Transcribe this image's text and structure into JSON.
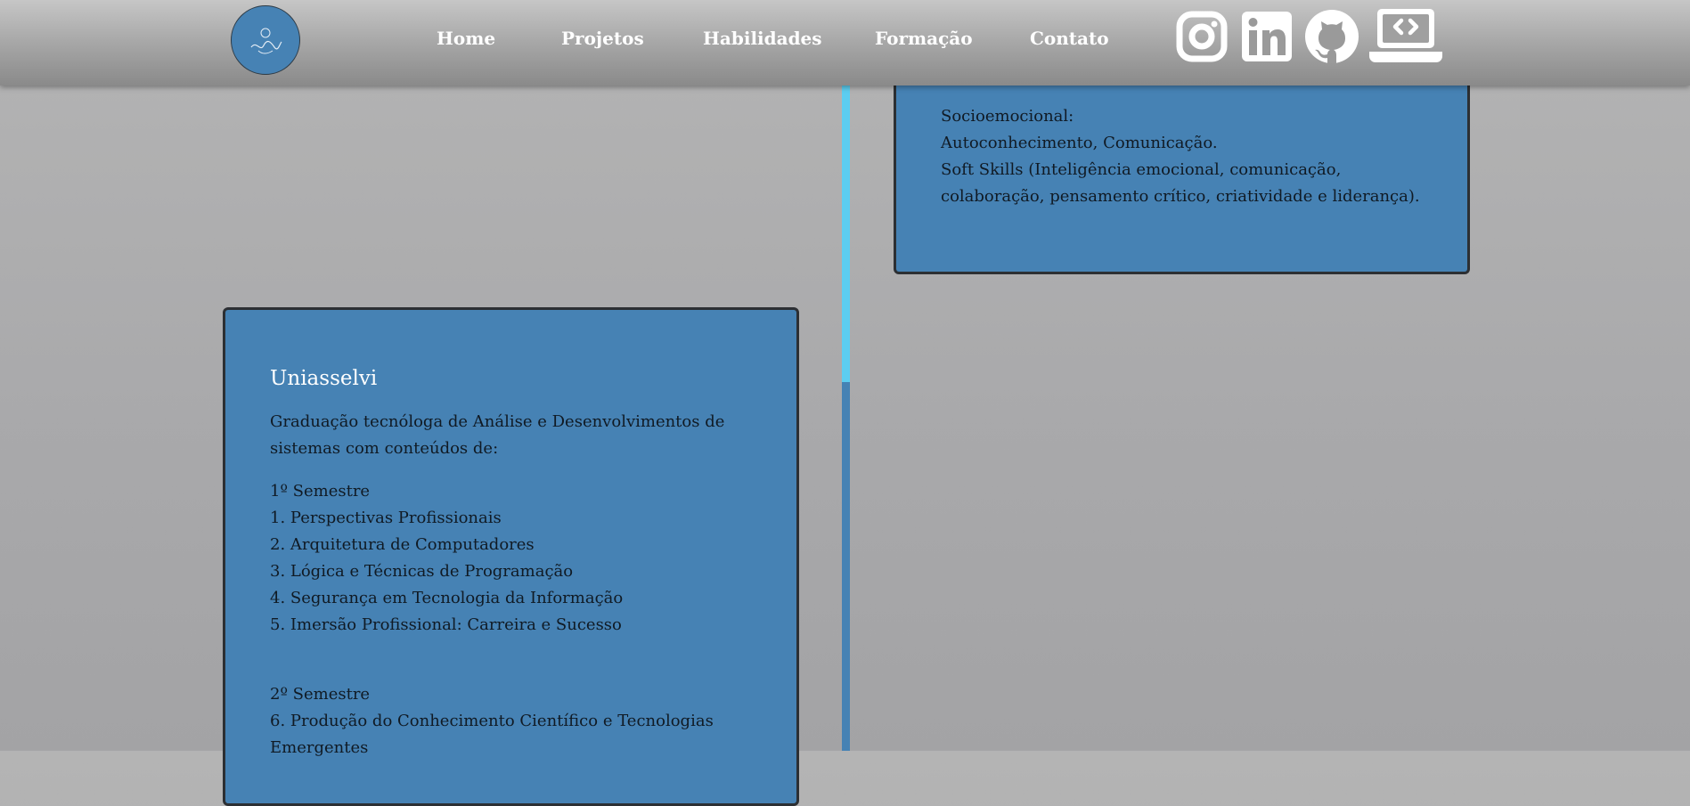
{
  "nav": {
    "logo": "logo-icon",
    "links": [
      "Home",
      "Projetos",
      "Habilidades",
      "Formação",
      "Contato"
    ],
    "social_icons": [
      "instagram-icon",
      "linkedin-icon",
      "github-icon",
      "laptop-code-icon"
    ]
  },
  "timeline": {
    "line_color": "#4682b4",
    "progress_color": "#5ccdf0"
  },
  "cards": {
    "top": {
      "lines": [
        "Socioemocional:",
        "Autoconhecimento, Comunicação.",
        "Soft Skills (Inteligência emocional, comunicação, colaboração, pensamento crítico, criatividade e liderança)."
      ]
    },
    "uniasselvi": {
      "title": "Uniasselvi",
      "intro": "Graduação tecnóloga de Análise e Desenvolvimentos de sistemas com conteúdos de:",
      "semester1_title": "1º Semestre",
      "semester1_items": [
        "1. Perspectivas Profissionais",
        "2. Arquitetura de Computadores",
        "3. Lógica e Técnicas de Programação",
        "4. Segurança em Tecnologia da Informação",
        "5. Imersão Profissional: Carreira e Sucesso"
      ],
      "semester2_title": "2º Semestre",
      "semester2_items": [
        "6. Produção do Conhecimento Científico e Tecnologias Emergentes"
      ]
    }
  },
  "colors": {
    "card_bg": "#4682b4",
    "card_border": "#2c2f33",
    "nav_text": "#ffffff"
  }
}
